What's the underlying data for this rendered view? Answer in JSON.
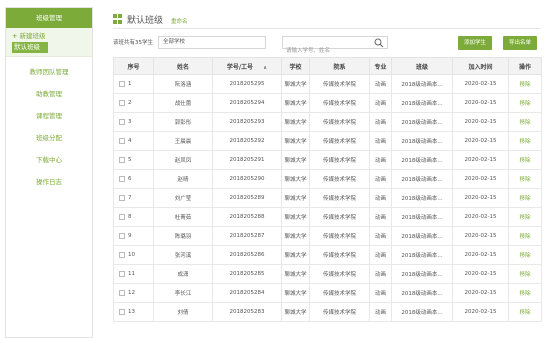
{
  "sidebar": {
    "title": "班级管理",
    "new_class": "新建班级",
    "default_class": "默认班级",
    "menu": [
      "教师团队管理",
      "助教管理",
      "课程管理",
      "班级分配",
      "下载中心",
      "操作日志"
    ]
  },
  "header": {
    "title": "默认班级",
    "rename": "重命名"
  },
  "toolbar": {
    "count_text": "该班共有35学生",
    "school_select": "全部学校",
    "search_placeholder": "请输入学号、姓名",
    "add_button": "添加学生",
    "export_button": "导出名单"
  },
  "table": {
    "headers": [
      "序号",
      "姓名",
      "学号/工号",
      "学校",
      "院系",
      "专业",
      "班级",
      "加入时间",
      "操作"
    ],
    "rows": [
      {
        "no": "1",
        "name": "阮洛涵",
        "id": "2018205295",
        "school": "聊城大学",
        "dept": "传媒技术学院",
        "major": "动画",
        "class": "2018级动画本...",
        "date": "2020-02-15",
        "action": "移除"
      },
      {
        "no": "2",
        "name": "战仕蕾",
        "id": "2018205294",
        "school": "聊城大学",
        "dept": "传媒技术学院",
        "major": "动画",
        "class": "2018级动画本...",
        "date": "2020-02-15",
        "action": "移除"
      },
      {
        "no": "3",
        "name": "郭彭彤",
        "id": "2018205293",
        "school": "聊城大学",
        "dept": "传媒技术学院",
        "major": "动画",
        "class": "2018级动画本...",
        "date": "2020-02-15",
        "action": "移除"
      },
      {
        "no": "4",
        "name": "王晨晨",
        "id": "2018205292",
        "school": "聊城大学",
        "dept": "传媒技术学院",
        "major": "动画",
        "class": "2018级动画本...",
        "date": "2020-02-15",
        "action": "移除"
      },
      {
        "no": "5",
        "name": "赵凤凤",
        "id": "2018205291",
        "school": "聊城大学",
        "dept": "传媒技术学院",
        "major": "动画",
        "class": "2018级动画本...",
        "date": "2020-02-15",
        "action": "移除"
      },
      {
        "no": "6",
        "name": "赵晴",
        "id": "2018205290",
        "school": "聊城大学",
        "dept": "传媒技术学院",
        "major": "动画",
        "class": "2018级动画本...",
        "date": "2020-02-15",
        "action": "移除"
      },
      {
        "no": "7",
        "name": "刘广莹",
        "id": "2018205289",
        "school": "聊城大学",
        "dept": "传媒技术学院",
        "major": "动画",
        "class": "2018级动画本...",
        "date": "2020-02-15",
        "action": "移除"
      },
      {
        "no": "8",
        "name": "杜菁茹",
        "id": "2018205288",
        "school": "聊城大学",
        "dept": "传媒技术学院",
        "major": "动画",
        "class": "2018级动画本...",
        "date": "2020-02-15",
        "action": "移除"
      },
      {
        "no": "9",
        "name": "陈璐羽",
        "id": "2018205287",
        "school": "聊城大学",
        "dept": "传媒技术学院",
        "major": "动画",
        "class": "2018级动画本...",
        "date": "2020-02-15",
        "action": "移除"
      },
      {
        "no": "10",
        "name": "张河溪",
        "id": "2018205286",
        "school": "聊城大学",
        "dept": "传媒技术学院",
        "major": "动画",
        "class": "2018级动画本...",
        "date": "2020-02-15",
        "action": "移除"
      },
      {
        "no": "11",
        "name": "成潇",
        "id": "2018205285",
        "school": "聊城大学",
        "dept": "传媒技术学院",
        "major": "动画",
        "class": "2018级动画本...",
        "date": "2020-02-15",
        "action": "移除"
      },
      {
        "no": "12",
        "name": "李长江",
        "id": "2018205284",
        "school": "聊城大学",
        "dept": "传媒技术学院",
        "major": "动画",
        "class": "2018级动画本...",
        "date": "2020-02-15",
        "action": "移除"
      },
      {
        "no": "13",
        "name": "刘倩",
        "id": "2018205283",
        "school": "聊城大学",
        "dept": "传媒技术学院",
        "major": "动画",
        "class": "2018级动画本...",
        "date": "2020-02-15",
        "action": "移除"
      }
    ]
  },
  "colors": {
    "accent": "#7cab3a",
    "header_bg": "#f3f3f3",
    "border": "#e4e4e4"
  },
  "icons": {
    "search": "search-icon",
    "grid": "grid-icon",
    "sort": "sort-asc-icon",
    "plus": "plus-icon"
  }
}
